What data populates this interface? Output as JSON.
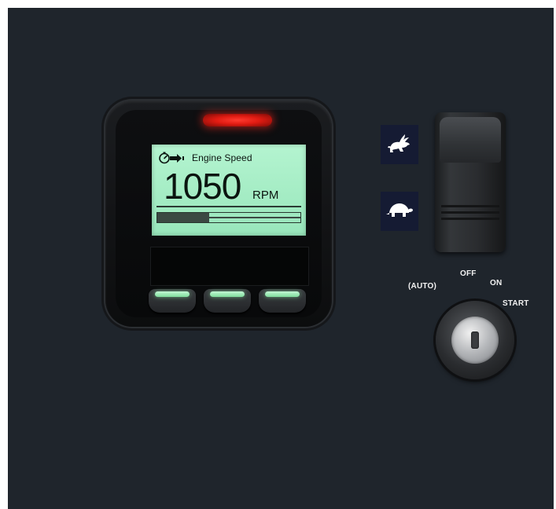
{
  "display": {
    "title": "Engine Speed",
    "value": "1050",
    "unit": "RPM",
    "bar_fill_fraction": 0.36,
    "accent_color": "#a8efc6",
    "led_color": "#ff2a1f",
    "softkeys": [
      "softkey-left",
      "softkey-center",
      "softkey-right"
    ]
  },
  "speed_control": {
    "fast_icon": "rabbit-icon",
    "slow_icon": "turtle-icon"
  },
  "key_switch": {
    "positions": {
      "auto": "(AUTO)",
      "off": "OFF",
      "on": "ON",
      "start": "START"
    }
  }
}
